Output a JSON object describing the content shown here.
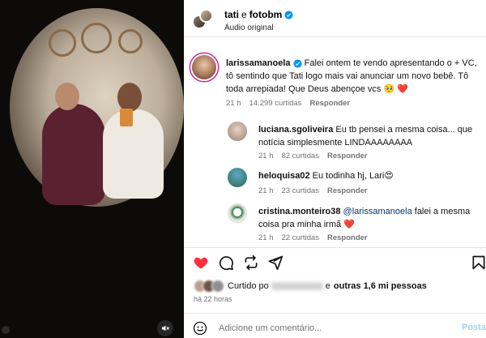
{
  "header": {
    "user1": "tati",
    "connector": "e",
    "user2": "fotobm",
    "audio": "Áudio original"
  },
  "comments": [
    {
      "user": "larissamanoela",
      "text": " Falei ontem te vendo apresentando o + VC, tô sentindo que Tati logo mais vai anunciar um novo bebê. Tô toda arrepiada! Que Deus abençoe vcs 🥺 ❤️",
      "time": "21 h",
      "likes": "14.299 curtidas",
      "reply": "Responder"
    },
    {
      "user": "luciana.sgoliveira",
      "text": " Eu tb pensei a mesma coisa... que notícia simplesmente LINDAAAAAAAA",
      "time": "21 h",
      "likes": "82 curtidas",
      "reply": "Responder"
    },
    {
      "user": "heloquisa02",
      "text": " Eu todinha hj, Lari😍",
      "time": "21 h",
      "likes": "23 curtidas",
      "reply": "Responder"
    },
    {
      "user": "cristina.monteiro38",
      "mention": " @larissamanoela",
      "text": " falei a mesma coisa pra minha irmã ❤️",
      "time": "21 h",
      "likes": "22 curtidas",
      "reply": "Responder"
    }
  ],
  "likes": {
    "prefix": "Curtido po",
    "suffix": " e",
    "others": "outras 1,6 mi pessoas"
  },
  "timestamp": "há 22 horas",
  "composer": {
    "placeholder": "Adicione um comentário...",
    "post_label": "Postar"
  },
  "colors": {
    "like_red": "#ff3040",
    "verified_blue": "#0095f6",
    "link_blue": "#00376b",
    "post_blue_disabled": "#9fd4f9",
    "muted_gray": "#737373"
  },
  "icons": {
    "like": "heart-filled-icon",
    "comment": "comment-bubble-icon",
    "share": "repost-icon",
    "send": "paper-plane-icon",
    "save": "bookmark-icon",
    "emoji": "smiley-icon",
    "mute": "speaker-muted-icon"
  }
}
